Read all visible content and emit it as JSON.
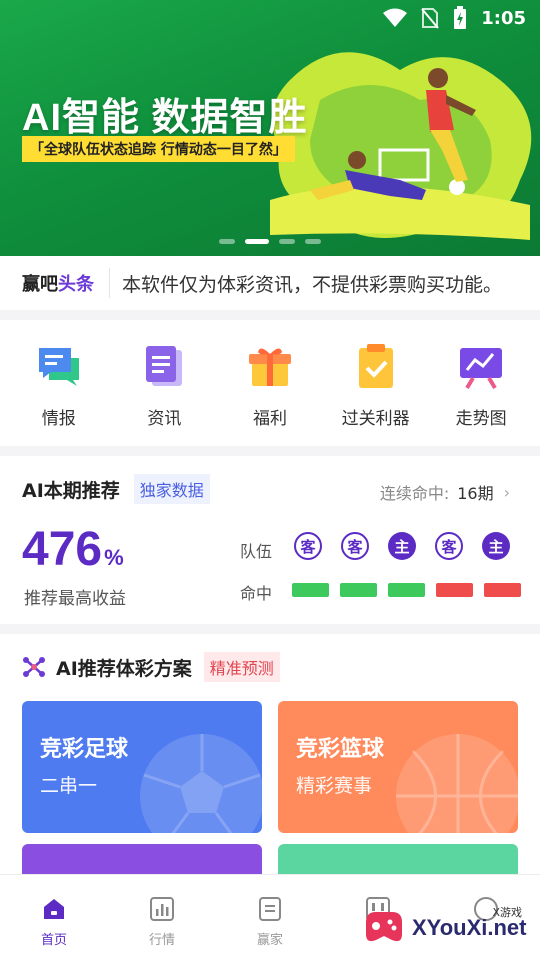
{
  "status_bar": {
    "time": "1:05"
  },
  "banner": {
    "title": "AI智能 数据智胜",
    "tagline": "「全球队伍状态追踪 行情动态一目了然」",
    "slide_count": 4,
    "active_slide": 2
  },
  "notice": {
    "logo_part1": "赢吧",
    "logo_part2": "头条",
    "text": "本软件仅为体彩资讯，不提供彩票购买功能。"
  },
  "menu": {
    "items": [
      {
        "label": "情报",
        "icon": "chat-bubble-icon"
      },
      {
        "label": "资讯",
        "icon": "document-icon"
      },
      {
        "label": "福利",
        "icon": "gift-icon"
      },
      {
        "label": "过关利器",
        "icon": "clipboard-check-icon"
      },
      {
        "label": "走势图",
        "icon": "trend-board-icon"
      }
    ]
  },
  "ai_card": {
    "title": "AI本期推荐",
    "badge": "独家数据",
    "streak_label": "连续命中:",
    "streak_value": "16期",
    "yield_value": "476",
    "yield_unit": "%",
    "yield_label": "推荐最高收益",
    "team_label": "队伍",
    "hit_label": "命中",
    "teams": [
      "客",
      "客",
      "主",
      "客",
      "主"
    ],
    "team_types": [
      "away",
      "away",
      "home",
      "away",
      "home"
    ],
    "hits": [
      "hit",
      "hit",
      "hit",
      "miss",
      "miss"
    ],
    "colors": {
      "accent": "#5b2bc4",
      "hit": "#3ec95c",
      "miss": "#ef4c4c"
    }
  },
  "plan": {
    "title": "AI推荐体彩方案",
    "badge": "精准预测",
    "tiles": [
      {
        "title": "竞彩足球",
        "subtitle": "二串一",
        "color": "#4f7bf0"
      },
      {
        "title": "竞彩篮球",
        "subtitle": "精彩赛事",
        "color": "#ff8a5c"
      },
      {
        "title": "",
        "subtitle": "",
        "color": "#8a4fe0"
      },
      {
        "title": "",
        "subtitle": "",
        "color": "#5cd6a0"
      }
    ]
  },
  "tabbar": {
    "items": [
      {
        "label": "首页",
        "icon": "home-icon",
        "active": true
      },
      {
        "label": "行情",
        "icon": "bar-chart-icon",
        "active": false
      },
      {
        "label": "赢家",
        "icon": "document-icon",
        "active": false
      },
      {
        "label": "",
        "icon": "scoreboard-icon",
        "active": false
      },
      {
        "label": "",
        "icon": "profile-icon",
        "active": false
      }
    ]
  },
  "watermark": {
    "text": "XYouXi.net",
    "small": "X游戏"
  }
}
